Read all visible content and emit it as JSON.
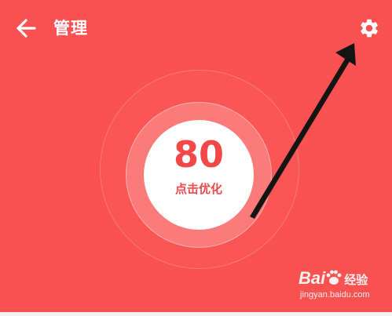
{
  "header": {
    "title": "管理",
    "back_icon": "arrow-left-icon",
    "settings_icon": "gear-icon"
  },
  "score": {
    "value": "80",
    "action_label": "点击优化"
  },
  "watermark": {
    "brand": "Bai",
    "brand_suffix": "经验",
    "url": "jingyan.baidu.com"
  },
  "colors": {
    "background": "#fa5151",
    "accent_text": "#f24848",
    "foreground": "#ffffff"
  }
}
